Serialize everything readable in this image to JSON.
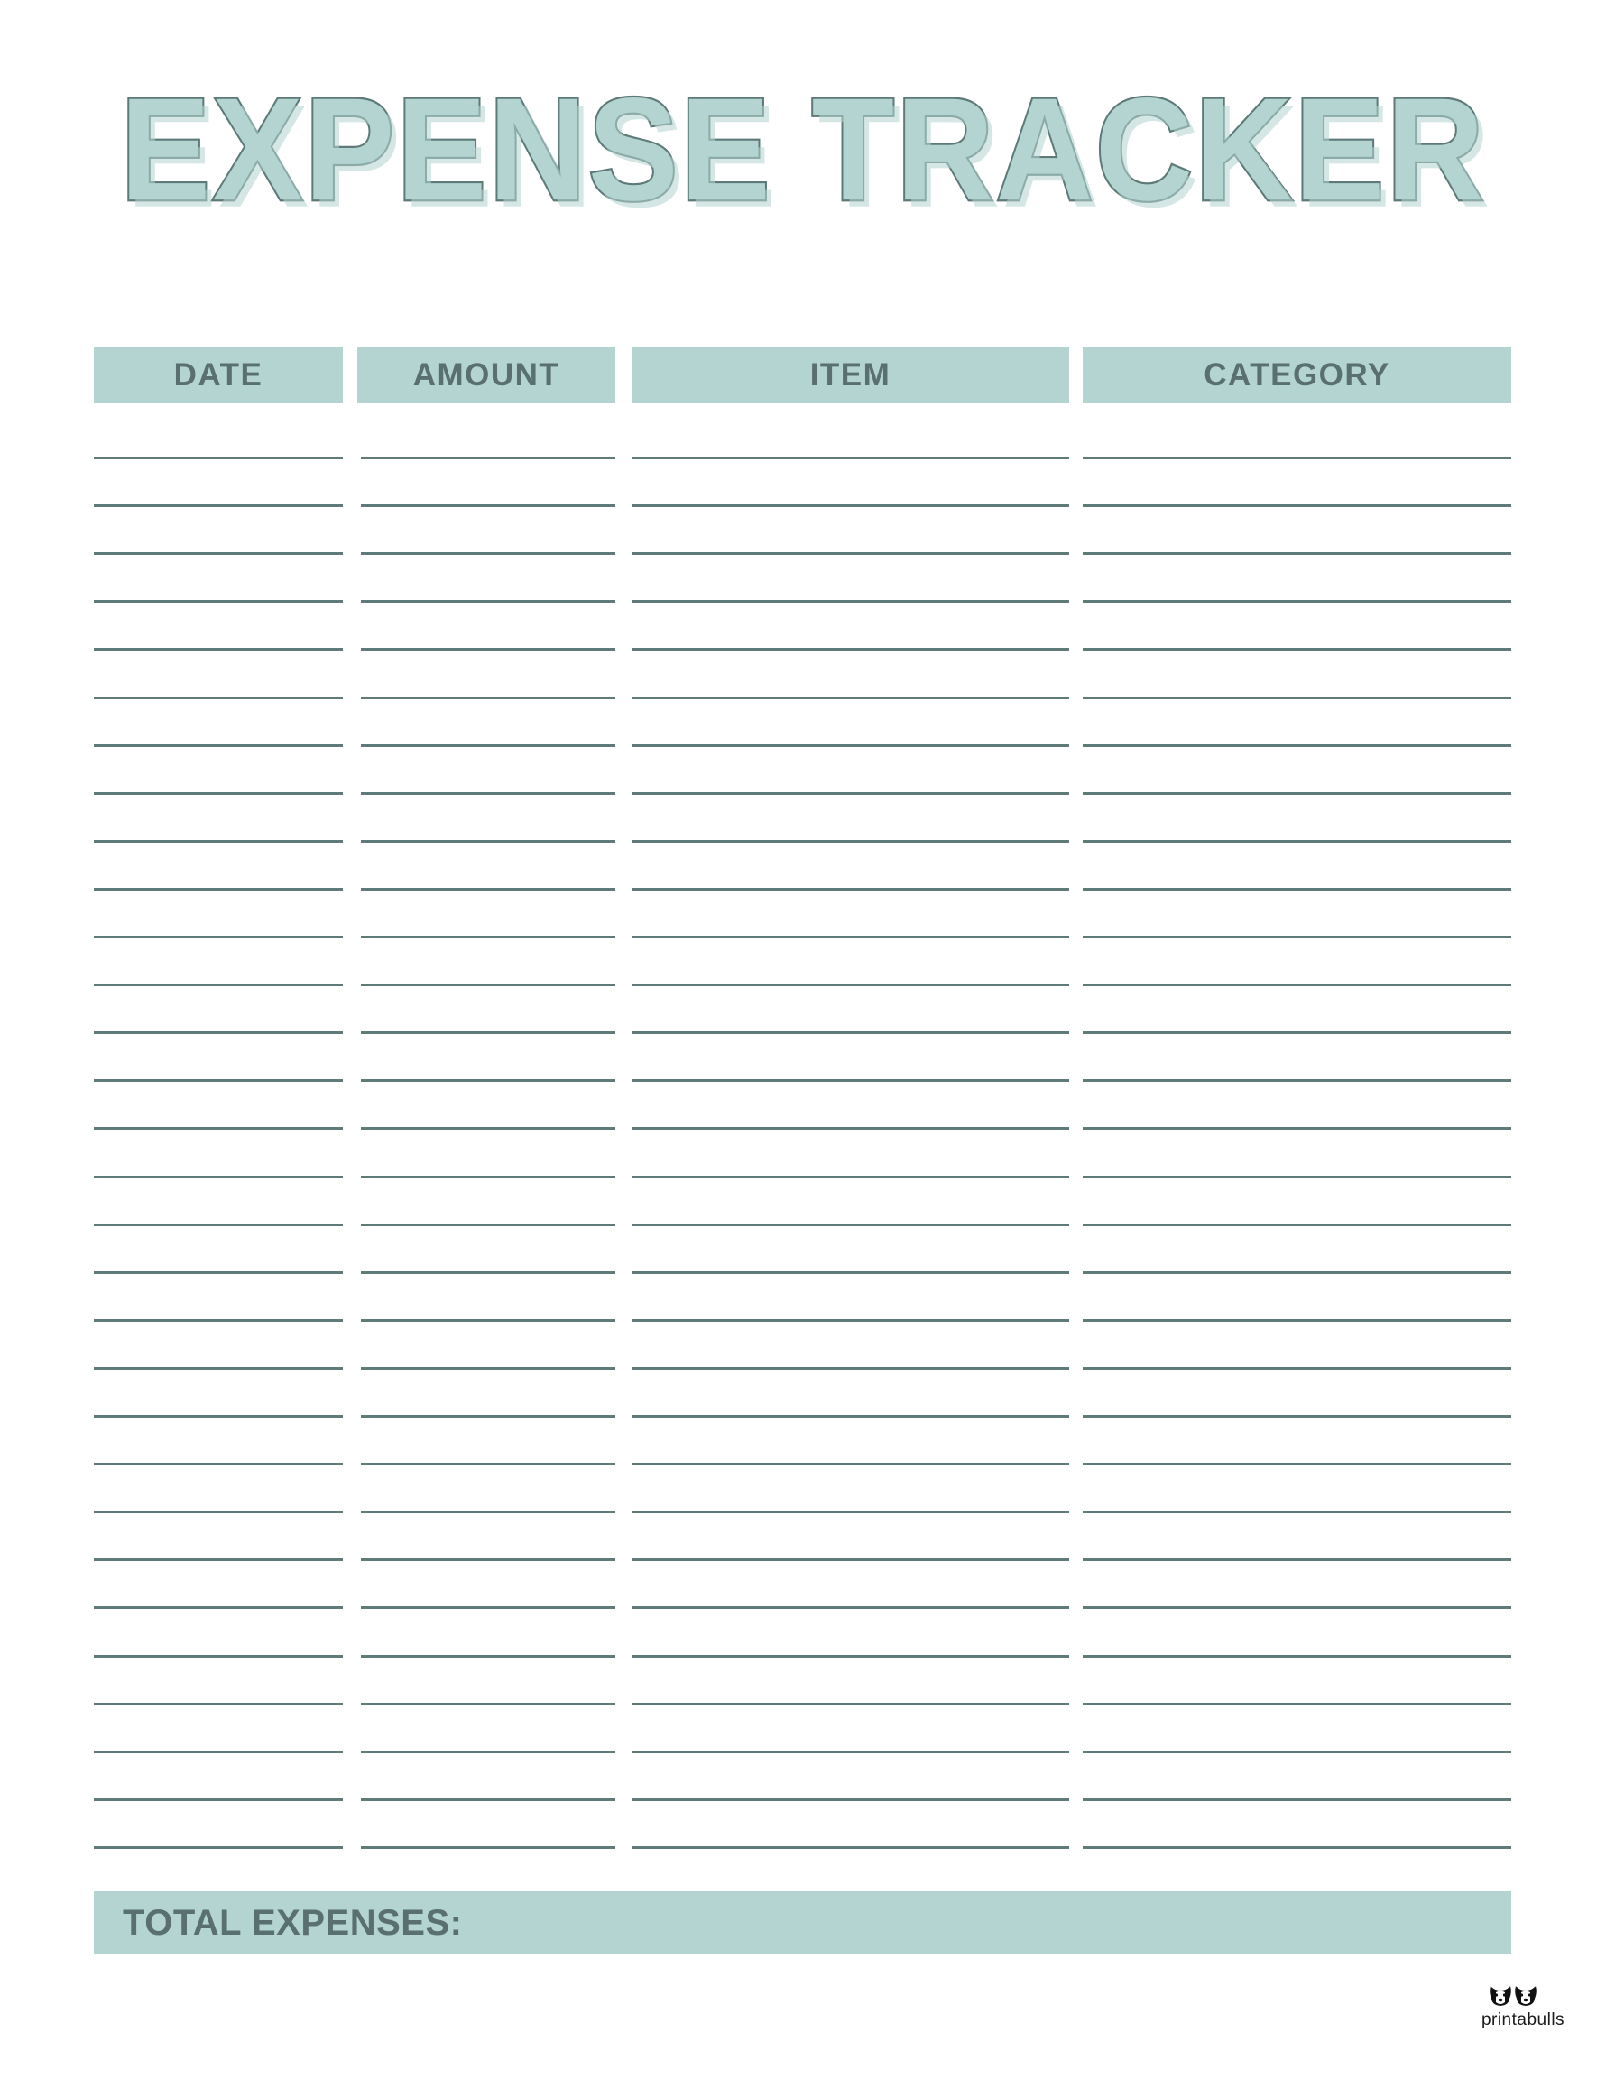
{
  "page": {
    "title": "EXPENSE TRACKER",
    "background_color": "#ffffff"
  },
  "theme": {
    "accent_fill": "#b3d4d0",
    "accent_outline": "#5d7a78",
    "text_color": "#5a706e",
    "rule_color": "#5f7b79"
  },
  "table": {
    "columns": [
      {
        "key": "date",
        "label": "DATE"
      },
      {
        "key": "amount",
        "label": "AMOUNT"
      },
      {
        "key": "item",
        "label": "ITEM"
      },
      {
        "key": "category",
        "label": "CATEGORY"
      }
    ],
    "row_count": 30,
    "rows": [
      {
        "date": "",
        "amount": "",
        "item": "",
        "category": ""
      },
      {
        "date": "",
        "amount": "",
        "item": "",
        "category": ""
      },
      {
        "date": "",
        "amount": "",
        "item": "",
        "category": ""
      },
      {
        "date": "",
        "amount": "",
        "item": "",
        "category": ""
      },
      {
        "date": "",
        "amount": "",
        "item": "",
        "category": ""
      },
      {
        "date": "",
        "amount": "",
        "item": "",
        "category": ""
      },
      {
        "date": "",
        "amount": "",
        "item": "",
        "category": ""
      },
      {
        "date": "",
        "amount": "",
        "item": "",
        "category": ""
      },
      {
        "date": "",
        "amount": "",
        "item": "",
        "category": ""
      },
      {
        "date": "",
        "amount": "",
        "item": "",
        "category": ""
      },
      {
        "date": "",
        "amount": "",
        "item": "",
        "category": ""
      },
      {
        "date": "",
        "amount": "",
        "item": "",
        "category": ""
      },
      {
        "date": "",
        "amount": "",
        "item": "",
        "category": ""
      },
      {
        "date": "",
        "amount": "",
        "item": "",
        "category": ""
      },
      {
        "date": "",
        "amount": "",
        "item": "",
        "category": ""
      },
      {
        "date": "",
        "amount": "",
        "item": "",
        "category": ""
      },
      {
        "date": "",
        "amount": "",
        "item": "",
        "category": ""
      },
      {
        "date": "",
        "amount": "",
        "item": "",
        "category": ""
      },
      {
        "date": "",
        "amount": "",
        "item": "",
        "category": ""
      },
      {
        "date": "",
        "amount": "",
        "item": "",
        "category": ""
      },
      {
        "date": "",
        "amount": "",
        "item": "",
        "category": ""
      },
      {
        "date": "",
        "amount": "",
        "item": "",
        "category": ""
      },
      {
        "date": "",
        "amount": "",
        "item": "",
        "category": ""
      },
      {
        "date": "",
        "amount": "",
        "item": "",
        "category": ""
      },
      {
        "date": "",
        "amount": "",
        "item": "",
        "category": ""
      },
      {
        "date": "",
        "amount": "",
        "item": "",
        "category": ""
      },
      {
        "date": "",
        "amount": "",
        "item": "",
        "category": ""
      },
      {
        "date": "",
        "amount": "",
        "item": "",
        "category": ""
      },
      {
        "date": "",
        "amount": "",
        "item": "",
        "category": ""
      },
      {
        "date": "",
        "amount": "",
        "item": "",
        "category": ""
      }
    ]
  },
  "total": {
    "label": "TOTAL EXPENSES:",
    "value": ""
  },
  "logo": {
    "name": "printabulls",
    "icon": "two-bulldog-faces-icon"
  }
}
